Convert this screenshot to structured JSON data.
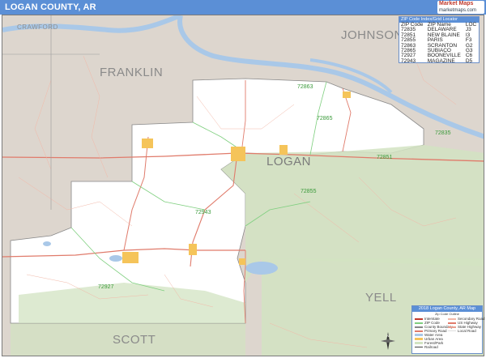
{
  "title": "LOGAN COUNTY, AR",
  "brand": {
    "line1": "Market Maps",
    "line2": "marketmaps.com"
  },
  "colors": {
    "title_bar": "#5b8fd6",
    "neighbor_fill": "#ddd6ce",
    "county_fill": "#ffffff",
    "forest": "#d2e3c2",
    "water": "#a9c8e8",
    "major_road": "#e07b6b",
    "minor_road": "#f2b8a8",
    "zip_boundary": "#7fcf7f",
    "urban": "#f5c45a"
  },
  "neighbor_counties": {
    "crawford": "CRAWFORD",
    "franklin": "FRANKLIN",
    "johnson": "JOHNSON",
    "scott": "SCOTT",
    "yell": "YELL"
  },
  "county_name": "LOGAN",
  "zip_labels": [
    {
      "code": "72863"
    },
    {
      "code": "72865"
    },
    {
      "code": "72851"
    },
    {
      "code": "72835"
    },
    {
      "code": "72855"
    },
    {
      "code": "72943"
    },
    {
      "code": "72927"
    }
  ],
  "zip_table": {
    "title": "ZIP Code Index/Grid Locator",
    "headers": [
      "ZIP Code",
      "ZIP Name",
      "LOC"
    ],
    "rows": [
      [
        "72835",
        "DELAWARE",
        "J3"
      ],
      [
        "72851",
        "NEW BLAINE",
        "I3"
      ],
      [
        "72855",
        "PARIS",
        "F3"
      ],
      [
        "72863",
        "SCRANTON",
        "G2"
      ],
      [
        "72865",
        "SUBIACO",
        "G3"
      ],
      [
        "72927",
        "BOONEVILLE",
        "C6"
      ],
      [
        "72943",
        "MAGAZINE",
        "D5"
      ]
    ]
  },
  "legend": {
    "title": "2018 Logan County, AR Map",
    "subtitle": "Zip Code Outline",
    "items_left": [
      "Interstate",
      "ZIP Code",
      "County Boundary",
      "Primary Road",
      "Water Area",
      "Urban Area",
      "Forest/Park",
      "Railroad"
    ],
    "items_right": [
      "Secondary Road",
      "US Highway",
      "State Highway",
      "Local Road"
    ]
  }
}
